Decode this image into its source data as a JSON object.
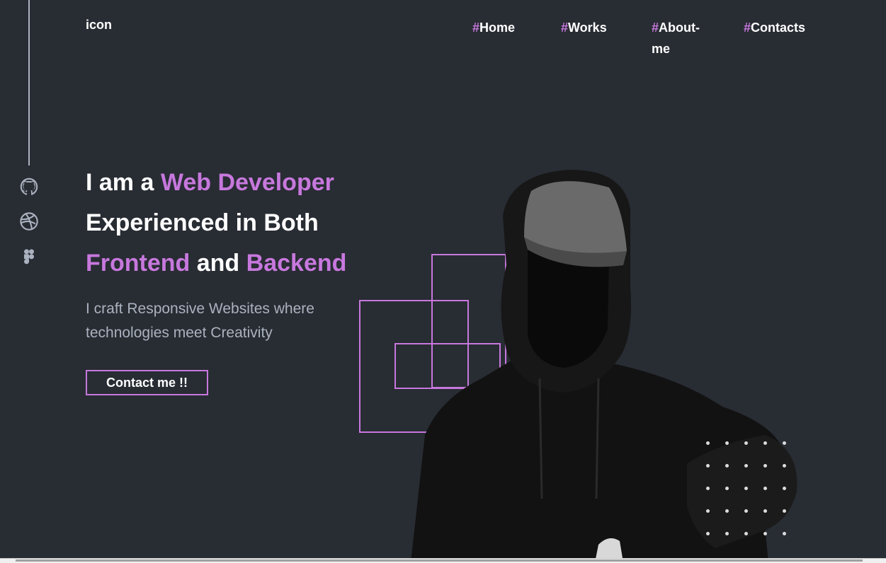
{
  "header": {
    "logo_text": "icon",
    "nav": [
      {
        "hash": "#",
        "label": "Home"
      },
      {
        "hash": "#",
        "label": "Works"
      },
      {
        "hash": "#",
        "label": "About-",
        "label2": "me"
      },
      {
        "hash": "#",
        "label": "Contacts"
      }
    ]
  },
  "sidebar": {
    "icons": [
      "github-icon",
      "dribbble-icon",
      "figma-icon"
    ]
  },
  "hero": {
    "line1_a": "I am a ",
    "line1_b": "Web Developer",
    "line2": "Experienced in Both",
    "line3_a": "Frontend",
    "line3_b": " and ",
    "line3_c": "Backend",
    "subtitle": "I craft Responsive Websites where technologies meet Creativity",
    "cta_label": "Contact me !!"
  },
  "colors": {
    "background": "#282c33",
    "accent": "#c778dd",
    "text": "#ffffff",
    "muted": "#abb2bf"
  }
}
